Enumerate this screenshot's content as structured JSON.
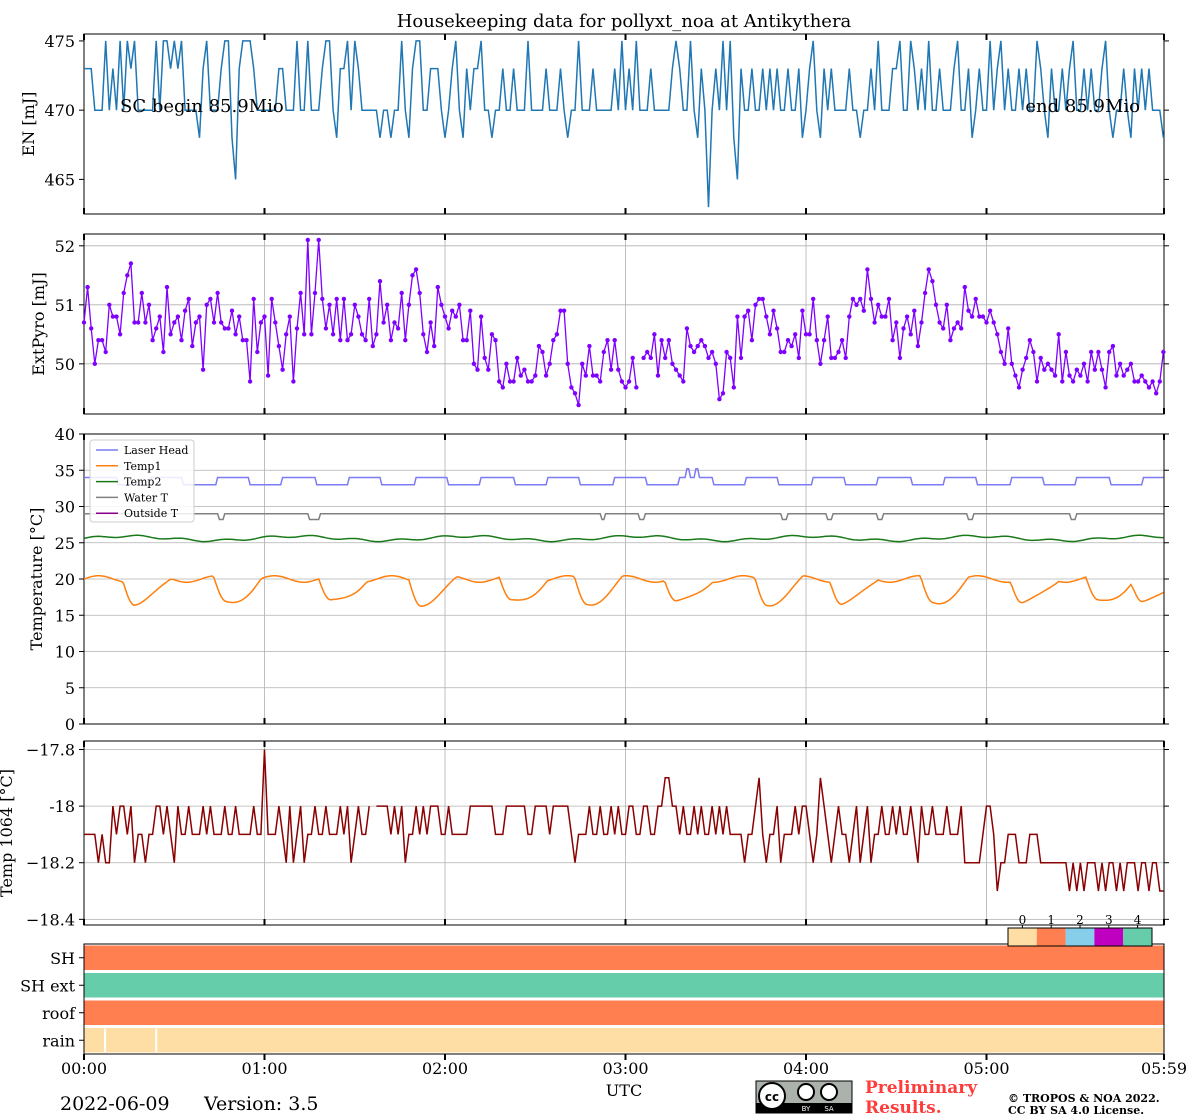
{
  "page": {
    "title": "Housekeeping data for pollyxt_noa at Antikythera",
    "date": "2022-06-09",
    "version": "Version: 3.5",
    "xlabel": "UTC",
    "preliminary_line1": "Preliminary",
    "preliminary_line2": "Results.",
    "copyright_line1": "© TROPOS & NOA 2022.",
    "copyright_line2": "CC BY SA 4.0 License.",
    "license_badge": {
      "by": "BY",
      "sa": "SA",
      "icon": "cc-by-sa-icon"
    }
  },
  "time_axis": {
    "tick_labels": [
      "00:00",
      "01:00",
      "02:00",
      "03:00",
      "04:00",
      "05:00",
      "05:59"
    ],
    "tick_minutes": [
      0,
      60,
      120,
      180,
      240,
      300,
      359
    ],
    "range_minutes": [
      0,
      359
    ]
  },
  "chart_data": [
    {
      "id": "energy",
      "type": "line",
      "ylabel": "EN [mJ]",
      "ylim": [
        462.5,
        475.5
      ],
      "yticks": [
        465,
        470,
        475
      ],
      "grid": false,
      "color": "#1f77b4",
      "annotations": [
        "SC begin 85.9Mio",
        "end 85.9Mio"
      ],
      "x_minutes_step": 1.2,
      "values": [
        473,
        473,
        473,
        470,
        470,
        470,
        475,
        470,
        473,
        470,
        475,
        470,
        475,
        473,
        475,
        470,
        470,
        470,
        470,
        470,
        475,
        470,
        475,
        475,
        473,
        475,
        473,
        475,
        470,
        470,
        470,
        470,
        468,
        473,
        475,
        470,
        470,
        470,
        473,
        475,
        475,
        468,
        465,
        473,
        475,
        475,
        475,
        473,
        470,
        470,
        470,
        470,
        470,
        470,
        473,
        473,
        470,
        470,
        470,
        475,
        470,
        470,
        475,
        470,
        470,
        470,
        473,
        475,
        475,
        470,
        468,
        473,
        473,
        475,
        470,
        475,
        473,
        470,
        470,
        470,
        470,
        470,
        468,
        470,
        470,
        468,
        470,
        470,
        475,
        470,
        468,
        473,
        475,
        475,
        470,
        470,
        473,
        473,
        473,
        470,
        468,
        470,
        473,
        475,
        470,
        468,
        473,
        470,
        473,
        473,
        475,
        470,
        470,
        468,
        470,
        470,
        473,
        470,
        470,
        473,
        470,
        470,
        470,
        475,
        470,
        470,
        470,
        470,
        473,
        470,
        470,
        470,
        473,
        470,
        468,
        470,
        470,
        475,
        470,
        470,
        470,
        473,
        470,
        470,
        470,
        470,
        470,
        473,
        470,
        475,
        470,
        473,
        470,
        475,
        470,
        470,
        470,
        473,
        470,
        470,
        470,
        470,
        470,
        473,
        475,
        473,
        470,
        470,
        475,
        470,
        468,
        473,
        470,
        463,
        470,
        473,
        470,
        475,
        470,
        475,
        468,
        465,
        473,
        470,
        470,
        473,
        470,
        470,
        473,
        470,
        473,
        470,
        473,
        470,
        470,
        473,
        470,
        470,
        473,
        468,
        470,
        473,
        475,
        470,
        468,
        473,
        470,
        473,
        470,
        470,
        470,
        470,
        473,
        470,
        470,
        468,
        470,
        470,
        473,
        470,
        475,
        470,
        470,
        470,
        473,
        473,
        475,
        470,
        470,
        475,
        473,
        470,
        473,
        470,
        475,
        470,
        470,
        473,
        470,
        470,
        470,
        473,
        475,
        470,
        470,
        473,
        468,
        470,
        473,
        470,
        470,
        475,
        470,
        473,
        475,
        470,
        473,
        470,
        470,
        473,
        470,
        473,
        470,
        470,
        475,
        473,
        470,
        468,
        473,
        470,
        470,
        473,
        470,
        473,
        475,
        470,
        470,
        473,
        470,
        473,
        470,
        470,
        473,
        475,
        470,
        468,
        470,
        470,
        473,
        470,
        468,
        473,
        470,
        473,
        470,
        473,
        470,
        470,
        470,
        468,
        470,
        468,
        473,
        470,
        470,
        473,
        470,
        470,
        470,
        473,
        473,
        473,
        470,
        475,
        470,
        475,
        473,
        473,
        475,
        470,
        473,
        475,
        470,
        475,
        473,
        473,
        475,
        470,
        470,
        470,
        475,
        473,
        473
      ]
    },
    {
      "id": "extpyro",
      "type": "line",
      "marker": "dot",
      "ylabel": "ExtPyro [mJ]",
      "ylim": [
        49.15,
        52.2
      ],
      "yticks": [
        50,
        51,
        52
      ],
      "grid": true,
      "color": "#7f00ff",
      "x_minutes_step": 1.2,
      "values": [
        50.7,
        51.3,
        50.6,
        50.0,
        50.4,
        50.4,
        50.2,
        51.0,
        50.8,
        50.8,
        50.5,
        51.2,
        51.5,
        51.7,
        50.7,
        50.7,
        51.2,
        50.7,
        51.0,
        50.4,
        50.6,
        50.8,
        50.2,
        51.3,
        50.5,
        50.7,
        50.8,
        50.4,
        50.9,
        51.1,
        50.3,
        50.7,
        50.8,
        49.9,
        51.0,
        51.1,
        50.7,
        51.2,
        50.7,
        50.6,
        50.6,
        50.9,
        50.5,
        50.8,
        50.4,
        50.4,
        49.7,
        51.1,
        50.2,
        50.7,
        50.8,
        49.8,
        51.1,
        50.7,
        50.3,
        49.9,
        50.5,
        50.8,
        49.7,
        50.6,
        51.2,
        50.5,
        52.1,
        50.5,
        51.2,
        52.1,
        51.1,
        50.6,
        51.0,
        50.5,
        51.1,
        50.4,
        51.1,
        50.4,
        50.5,
        51.0,
        50.8,
        50.5,
        50.4,
        51.1,
        50.3,
        50.5,
        51.4,
        50.7,
        51.0,
        50.4,
        50.7,
        50.6,
        51.2,
        50.4,
        51.0,
        51.5,
        51.6,
        51.2,
        50.5,
        50.2,
        50.7,
        50.3,
        51.3,
        51.0,
        50.8,
        50.6,
        50.9,
        50.8,
        51.0,
        50.4,
        50.4,
        50.9,
        50.0,
        49.9,
        50.8,
        50.1,
        49.9,
        50.5,
        50.4,
        49.7,
        49.6,
        50.0,
        49.7,
        49.7,
        50.1,
        49.8,
        49.9,
        49.7,
        49.7,
        49.8,
        50.3,
        50.2,
        49.8,
        50.0,
        50.4,
        50.5,
        50.9,
        50.9,
        50.0,
        49.6,
        49.5,
        49.3,
        50.0,
        49.8,
        50.3,
        49.8,
        49.8,
        49.7,
        50.2,
        50.4,
        49.9,
        50.4,
        49.9,
        49.7,
        49.6,
        49.7,
        50.1,
        49.6,
        49.9,
        50.1,
        50.2,
        50.1,
        50.5,
        49.8,
        50.4,
        50.1,
        50.4,
        50.0,
        49.9,
        49.8,
        49.7,
        50.6,
        50.3,
        50.2,
        50.3,
        50.4,
        50.3,
        50.1,
        50.2,
        50.0,
        49.4,
        49.5,
        50.2,
        50.1,
        49.6,
        50.8,
        50.1,
        50.8,
        50.9,
        50.4,
        51.0,
        51.1,
        51.1,
        50.8,
        50.5,
        50.9,
        50.6,
        50.2,
        50.2,
        50.4,
        50.3,
        50.5,
        50.1,
        50.9,
        50.5,
        50.5,
        51.1,
        50.4,
        50.0,
        50.4,
        50.8,
        50.1,
        50.1,
        50.2,
        50.4,
        50.1,
        50.8,
        51.1,
        51.0,
        51.1,
        50.9,
        51.6,
        51.1,
        50.7,
        51.0,
        50.8,
        50.8,
        51.1,
        50.4,
        50.7,
        50.1,
        50.6,
        50.8,
        50.5,
        50.9,
        50.3,
        50.7,
        51.2,
        51.6,
        51.4,
        51.0,
        50.7,
        50.6,
        51.0,
        50.4,
        50.6,
        50.7,
        50.6,
        51.3,
        50.9,
        50.8,
        51.1,
        50.8,
        50.8,
        50.7,
        50.9,
        50.7,
        50.5,
        50.2,
        50.0,
        50.6,
        50.0,
        49.8,
        49.6,
        49.9,
        50.1,
        50.4,
        50.2,
        49.7,
        50.1,
        49.9,
        50.0,
        49.9,
        49.8,
        50.5,
        49.7,
        50.2,
        49.8,
        49.7,
        49.9,
        49.8,
        50.0,
        49.7,
        50.2,
        49.9,
        50.2,
        49.9,
        49.6,
        50.2,
        50.3,
        49.8,
        50.0,
        49.8,
        49.9,
        50.0,
        49.7,
        49.7,
        49.8,
        49.7,
        49.6,
        49.7,
        49.5,
        49.7,
        50.2,
        50.5,
        50.0,
        49.9,
        50.2,
        50.5,
        50.4,
        50.6,
        50.0,
        50.3,
        50.5,
        50.3,
        50.0,
        50.4,
        50.5,
        50.6,
        50.4,
        50.7,
        50.6,
        50.9,
        50.7,
        51.0,
        50.6,
        51.0,
        51.0,
        50.6,
        50.8,
        51.2,
        50.8,
        50.8,
        50.9,
        51.6,
        51.4,
        51.6,
        50.9,
        51.3,
        50.8,
        50.9,
        50.9,
        50.5,
        50.0,
        50.1,
        49.8,
        51.2
      ]
    },
    {
      "id": "temperature",
      "type": "line",
      "ylabel": "Temperature [$^\\circ C$]",
      "ylim": [
        0,
        40
      ],
      "yticks": [
        0,
        5,
        10,
        15,
        20,
        25,
        30,
        35,
        40
      ],
      "grid": true,
      "legend_position": "upper-left",
      "series": [
        {
          "name": "Laser Head",
          "color": "#7b7bf5",
          "base": 33.5,
          "kind": "laser"
        },
        {
          "name": "Temp1",
          "color": "#ff7f0e",
          "base": 19.5,
          "kind": "temp1"
        },
        {
          "name": "Temp2",
          "color": "#1a7a1a",
          "base": 25.6,
          "kind": "temp2"
        },
        {
          "name": "Water T",
          "color": "#808080",
          "base": 29.0,
          "kind": "water"
        },
        {
          "name": "Outside T",
          "color": "#8b008b",
          "base": null,
          "kind": "none"
        }
      ],
      "temp1_dip_minutes": [
        15,
        45,
        80,
        110,
        140,
        165,
        195,
        225,
        250,
        280,
        310,
        335,
        350
      ],
      "water_dip_minutes": [
        45.5,
        75.5,
        77.5,
        172.5,
        185.5,
        232.5,
        247.5,
        264.5,
        294.5,
        328.5
      ],
      "laser_bump_minutes": [
        200.5,
        203.5
      ]
    },
    {
      "id": "temp1064",
      "type": "line",
      "ylabel": "Temp 1064 [$^\\circ C$]",
      "ylim": [
        -18.42,
        -17.77
      ],
      "yticks": [
        -18.4,
        -18.2,
        -18.0,
        -17.8
      ],
      "grid": true,
      "color": "#8b0000",
      "x_minutes_step": 1.2,
      "values": [
        -18.1,
        -18.1,
        -18.1,
        -18.1,
        -18.2,
        -18.1,
        -18.2,
        -18.2,
        -18.0,
        -18.1,
        -18.0,
        -18.0,
        -18.1,
        -18.0,
        -18.2,
        -18.1,
        -18.1,
        -18.2,
        -18.1,
        -18.1,
        -18.0,
        -18.0,
        -18.1,
        -18.0,
        -18.1,
        -18.2,
        -18.0,
        -18.1,
        -18.1,
        -18.0,
        -18.1,
        -18.1,
        -18.1,
        -18.0,
        -18.1,
        -18.0,
        -18.1,
        -18.1,
        -18.1,
        -18.0,
        -18.1,
        -18.1,
        -18.0,
        -18.1,
        -18.1,
        -18.1,
        -18.1,
        -18.0,
        -18.1,
        -18.1,
        -17.8,
        -18.1,
        -18.1,
        -18.1,
        -18.0,
        -18.1,
        -18.2,
        -18.0,
        -18.2,
        -18.1,
        -18.0,
        -18.2,
        -18.1,
        -18.1,
        -18.0,
        -18.1,
        -18.1,
        -18.0,
        -18.1,
        -18.1,
        -18.1,
        -18.0,
        -18.1,
        -18.0,
        -18.2,
        -18.1,
        -18.0,
        -18.1,
        -18.1,
        -18.0,
        null,
        -18.0,
        -18.0,
        -18.0,
        -18.0,
        -18.1,
        -18.0,
        -18.1,
        -18.0,
        -18.2,
        -18.1,
        -18.1,
        -18.0,
        -18.1,
        -18.0,
        -18.1,
        -18.0,
        -18.0,
        -18.0,
        -18.1,
        -18.1,
        -18.0,
        -18.1,
        -18.1,
        -18.1,
        -18.1,
        -18.1,
        -18.0,
        -18.0,
        -18.0,
        -18.0,
        -18.0,
        -18.0,
        -18.0,
        -18.1,
        -18.1,
        -18.1,
        -18.0,
        -18.0,
        -18.0,
        -18.0,
        -18.0,
        -18.0,
        -18.1,
        -18.1,
        -18.0,
        -18.0,
        -18.0,
        -18.0,
        -18.1,
        -18.0,
        -18.0,
        -18.0,
        -18.0,
        -18.0,
        -18.1,
        -18.2,
        -18.1,
        -18.1,
        -18.1,
        -18.0,
        -18.1,
        -18.1,
        -18.0,
        -18.1,
        -18.1,
        -18.0,
        -18.1,
        -18.0,
        -18.1,
        -18.1,
        -18.0,
        -18.0,
        -18.1,
        -18.1,
        -18.0,
        -18.0,
        -18.1,
        -18.1,
        -18.0,
        -18.0,
        -17.9,
        -17.9,
        -18.0,
        -18.0,
        -18.1,
        -18.0,
        -18.1,
        -18.1,
        -18.0,
        -18.1,
        -18.0,
        -18.1,
        -18.1,
        -18.0,
        -18.1,
        -18.0,
        -18.1,
        -18.0,
        -18.1,
        -18.1,
        -18.1,
        -18.1,
        -18.2,
        -18.1,
        -18.1,
        -18.0,
        -17.9,
        -18.1,
        -18.2,
        -18.1,
        -18.1,
        -18.0,
        -18.2,
        -18.1,
        -18.1,
        -18.1,
        -18.0,
        -18.1,
        -18.0,
        -18.0,
        -18.1,
        -18.2,
        -18.1,
        -17.9,
        -18.0,
        -18.1,
        -18.2,
        -18.1,
        -18.0,
        -18.1,
        -18.1,
        -18.2,
        -18.1,
        -18.0,
        -18.2,
        -18.1,
        -18.0,
        -18.2,
        -18.1,
        -18.1,
        -18.0,
        -18.1,
        -18.1,
        -18.0,
        -18.1,
        -18.0,
        -18.1,
        -18.1,
        -18.0,
        -18.1,
        -18.2,
        -18.0,
        -18.1,
        -18.1,
        -18.0,
        -18.1,
        -18.1,
        -18.1,
        -18.0,
        -18.1,
        -18.1,
        -18.1,
        -18.0,
        -18.2,
        -18.2,
        -18.2,
        -18.2,
        -18.2,
        -18.1,
        -18.0,
        -18.0,
        -18.1,
        -18.3,
        -18.2,
        -18.2,
        -18.1,
        -18.1,
        -18.1,
        -18.2,
        -18.2,
        -18.2,
        -18.1,
        -18.1,
        -18.1,
        -18.2,
        -18.2,
        -18.2,
        -18.2,
        -18.2,
        -18.2,
        -18.2,
        -18.2,
        -18.3,
        -18.2,
        -18.3,
        -18.2,
        -18.3,
        -18.2,
        -18.2,
        -18.2,
        -18.3,
        -18.2,
        -18.3,
        -18.2,
        -18.2,
        -18.3,
        -18.2,
        -18.3,
        -18.2,
        -18.2,
        -18.2,
        -18.3,
        -18.2,
        -18.2,
        -18.3,
        -18.2,
        -18.2,
        -18.3,
        -18.3,
        -18.3,
        -18.4,
        -18.3,
        -18.3,
        -18.3,
        -18.3,
        -18.2,
        -18.2,
        -18.2,
        -18.3,
        -18.3,
        -18.1,
        -18.3,
        -18.3
      ]
    },
    {
      "id": "status",
      "type": "heatmap",
      "rows": [
        "SH",
        "SH ext",
        "roof",
        "rain"
      ],
      "row_states": [
        1,
        4,
        1,
        0
      ],
      "rain_markers_minutes": [
        7,
        24
      ],
      "colorbar_labels": [
        "0",
        "1",
        "2",
        "3",
        "4"
      ],
      "colorbar_colors": [
        "#ffdea6",
        "#ff7f50",
        "#87ceeb",
        "#c000c0",
        "#66cdaa"
      ]
    }
  ]
}
